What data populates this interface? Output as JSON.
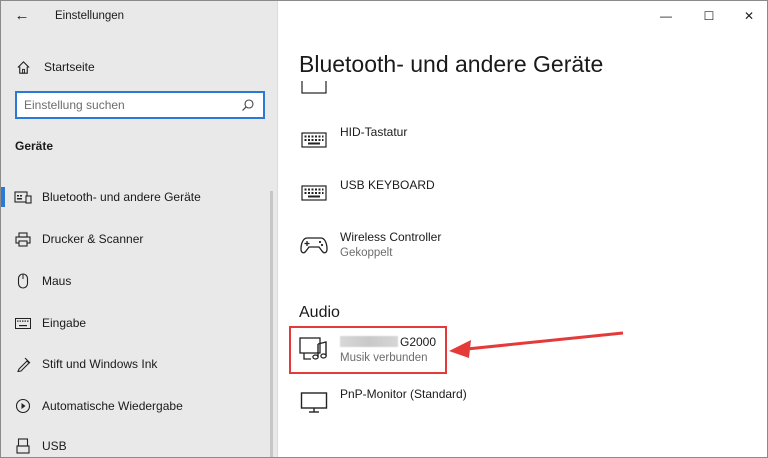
{
  "window": {
    "app_title": "Einstellungen",
    "back_glyph": "←",
    "minimize_glyph": "—",
    "maximize_glyph": "☐",
    "close_glyph": "✕"
  },
  "sidebar": {
    "home_label": "Startseite",
    "search_placeholder": "Einstellung suchen",
    "section_label": "Geräte",
    "items": [
      {
        "label": "Bluetooth- und andere Geräte",
        "icon": "bluetooth-devices-icon",
        "selected": true
      },
      {
        "label": "Drucker & Scanner",
        "icon": "printer-icon"
      },
      {
        "label": "Maus",
        "icon": "mouse-icon"
      },
      {
        "label": "Eingabe",
        "icon": "keyboard-icon"
      },
      {
        "label": "Stift und Windows Ink",
        "icon": "pen-icon"
      },
      {
        "label": "Automatische Wiedergabe",
        "icon": "autoplay-icon"
      },
      {
        "label": "USB",
        "icon": "usb-icon"
      }
    ]
  },
  "main": {
    "title": "Bluetooth- und andere Geräte",
    "devices": [
      {
        "name": "HID-Tastatur",
        "icon": "keyboard-icon"
      },
      {
        "name": "USB KEYBOARD",
        "icon": "keyboard-icon"
      },
      {
        "name": "Wireless Controller",
        "status": "Gekoppelt",
        "icon": "gamepad-icon"
      }
    ],
    "audio_section": "Audio",
    "audio_devices": [
      {
        "name": "G2000",
        "status": "Musik verbunden",
        "icon": "speaker-music-icon"
      },
      {
        "name": "PnP-Monitor (Standard)",
        "icon": "monitor-icon"
      }
    ]
  },
  "annotation": {
    "color": "#e53a3a"
  },
  "colors": {
    "accent": "#2a79d6",
    "sidebar_bg": "#e9e9e9"
  }
}
